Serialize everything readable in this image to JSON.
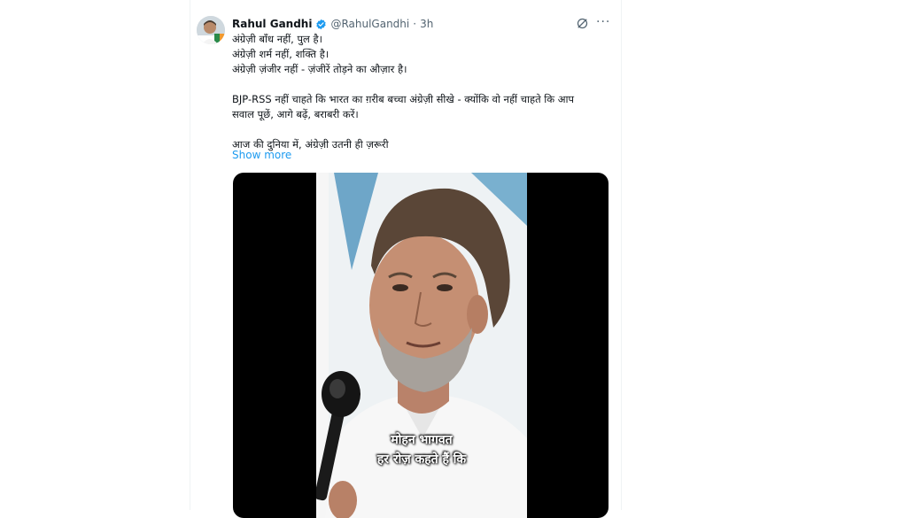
{
  "post": {
    "author_name": "Rahul Gandhi",
    "author_handle": "@RahulGandhi",
    "separator": "·",
    "time": "3h",
    "more_label": "···",
    "lines": [
      "अंग्रेज़ी बाँध नहीं, पुल है।",
      "अंग्रेज़ी शर्म नहीं, शक्ति है।",
      "अंग्रेज़ी ज़ंजीर नहीं - ज़ंजीरें तोड़ने का औज़ार है।",
      "",
      "BJP-RSS नहीं चाहते कि भारत का ग़रीब बच्चा अंग्रेज़ी सीखे - क्योंकि वो नहीं चाहते कि आप",
      "सवाल पूछें, आगे बढ़ें, बराबरी करें।",
      "",
      "आज की दुनिया में, अंग्रेज़ी उतनी ही ज़रूरी"
    ],
    "show_more": "Show more",
    "verified_color": "#1d9bf0"
  },
  "video": {
    "caption_line_1": "मोहन भागवत",
    "caption_line_2": "हर रोज़ कहते हैं कि"
  },
  "icons": {
    "verified": "verified-badge-icon",
    "grok": "grok-icon",
    "more": "more-options-icon",
    "microphone": "microphone"
  }
}
